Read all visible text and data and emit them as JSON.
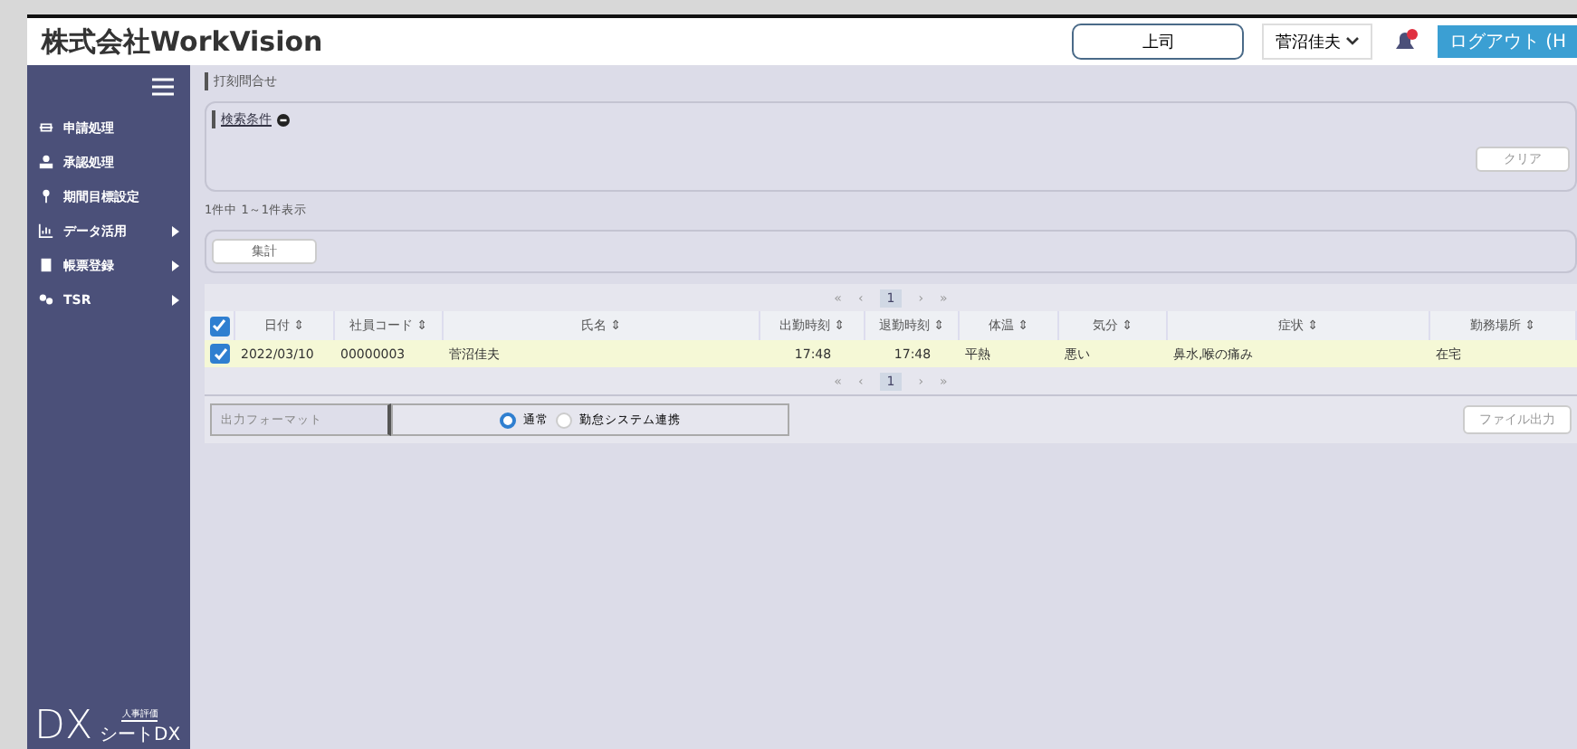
{
  "header": {
    "title": "株式会社WorkVision",
    "role_button": "上司",
    "user_menu": "菅沼佳夫",
    "notification": {
      "unread": true
    },
    "logout": "ログアウト (H"
  },
  "sidebar": {
    "items": [
      {
        "label": "申請処理",
        "submenu": false
      },
      {
        "label": "承認処理",
        "submenu": false
      },
      {
        "label": "期間目標設定",
        "submenu": false
      },
      {
        "label": "データ活用",
        "submenu": true
      },
      {
        "label": "帳票登録",
        "submenu": true
      },
      {
        "label": "TSR",
        "submenu": true
      }
    ],
    "logo": {
      "mark": "DX",
      "caption": "人事評価",
      "name": "シートDX"
    }
  },
  "page_title": "打刻問合せ",
  "search": {
    "label": "検索条件",
    "clear": "クリア"
  },
  "result_count": "1件中 1～1件表示",
  "action_button": "集計",
  "pagination": [
    {
      "first": "«",
      "prev": "‹",
      "page": "1",
      "next": "›",
      "last": "»"
    },
    {
      "first": "«",
      "prev": "‹",
      "page": "1",
      "next": "›",
      "last": "»"
    }
  ],
  "table": {
    "all_checked": true,
    "columns": [
      "日付 ⇕",
      "社員コード ⇕",
      "氏名 ⇕",
      "出勤時刻 ⇕",
      "退勤時刻 ⇕",
      "体温 ⇕",
      "気分 ⇕",
      "症状 ⇕",
      "勤務場所 ⇕"
    ],
    "rows": [
      {
        "checked": true,
        "cells": [
          "2022/03/10",
          "00000003",
          "菅沼佳夫",
          "17:48",
          "17:48",
          "平熱",
          "悪い",
          "鼻水,喉の痛み",
          "在宅"
        ]
      }
    ]
  },
  "output": {
    "label": "出力フォーマット",
    "options": [
      {
        "label": "通常",
        "selected": true
      },
      {
        "label": "勤怠システム連携",
        "selected": false
      }
    ],
    "button": "ファイル出力"
  }
}
